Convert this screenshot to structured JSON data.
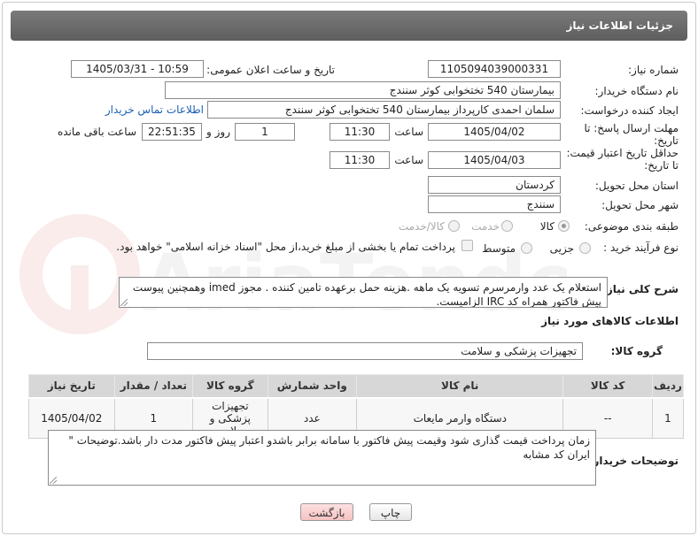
{
  "title": "جزئیات اطلاعات نیاز",
  "fields": {
    "need_number_label": "شماره نیاز:",
    "need_number": "1105094039000331",
    "announce_label": "تاریخ و ساعت اعلان عمومی:",
    "announce_value": "1405/03/31 - 10:59",
    "buyer_org_label": "نام دستگاه خریدار:",
    "buyer_org": "بیمارستان 540 تختخوابی کوثر سنندج",
    "requester_label": "ایجاد کننده درخواست:",
    "requester": "سلمان احمدی کارپرداز بیمارستان 540 تختخوابی کوثر سنندج",
    "contact_link": "اطلاعات تماس خریدار",
    "reply_deadline_label": "مهلت ارسال پاسخ: تا تاریخ:",
    "reply_date": "1405/04/02",
    "hour_label": "ساعت",
    "reply_time": "11:30",
    "days_value": "1",
    "days_label": "روز و",
    "remaining_time": "22:51:35",
    "remaining_label": "ساعت باقی مانده",
    "price_validity_label": "حداقل تاریخ اعتبار قیمت: تا تاریخ:",
    "validity_date": "1405/04/03",
    "validity_time": "11:30",
    "province_label": "استان محل تحویل:",
    "province": "کردستان",
    "city_label": "شهر محل تحویل:",
    "city": "سنندج",
    "category_label": "طبقه بندی موضوعی:",
    "category_options": [
      "کالا",
      "خدمت",
      "کالا/خدمت"
    ],
    "process_label": "نوع فرآیند خرید :",
    "process_options": [
      "جزیی",
      "متوسط"
    ],
    "treasury_note": "پرداخت تمام یا بخشی از مبلغ خرید،از محل \"اسناد خزانه اسلامی\" خواهد بود.",
    "description_label": "شرح کلی نیاز:",
    "description": "استعلام یک عدد وارمرسرم   تسویه یک ماهه .هزینه حمل برعهده تامین کننده . مجوز imed وهمچنین پیوست پیش فاکتور همراه کد IRC  الزامیست.",
    "goods_info_title": "اطلاعات کالاهای مورد نیاز",
    "goods_group_label": "گروه کالا:",
    "goods_group": "تجهیزات پزشکی و سلامت",
    "buyer_notes_label": "توضیحات خریدار:",
    "buyer_notes": "زمان پرداخت قیمت گذاری شود وقیمت پیش فاکتور با سامانه برابر باشدو اعتبار پیش فاکتور مدت دار باشد.توضیحات \" ایران کد مشابه"
  },
  "table": {
    "headers": [
      "ردیف",
      "کد کالا",
      "نام کالا",
      "واحد شمارش",
      "گروه کالا",
      "تعداد / مقدار",
      "تاریخ نیاز"
    ],
    "rows": [
      [
        "1",
        "--",
        "دستگاه وارمر مایعات",
        "عدد",
        "تجهیزات پزشکی و سلامت",
        "1",
        "1405/04/02"
      ]
    ]
  },
  "buttons": {
    "print": "چاپ",
    "back": "بازگشت"
  },
  "watermark": "AriaTender.net"
}
